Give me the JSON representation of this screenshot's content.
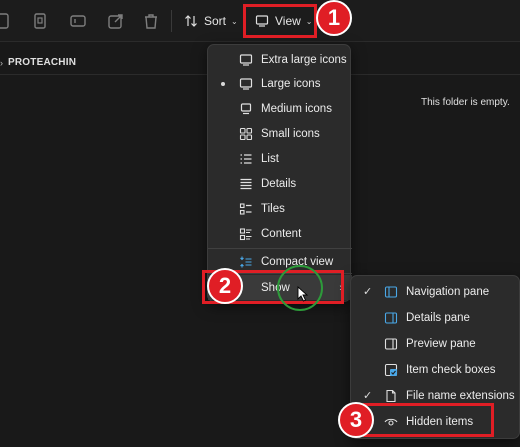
{
  "toolbar": {
    "sort_label": "Sort",
    "view_label": "View"
  },
  "address": {
    "folder": "PROTEACHIN"
  },
  "content": {
    "empty_message": "This folder is empty."
  },
  "view_menu": {
    "items": [
      {
        "label": "Extra large icons",
        "icon": "monitor-icon"
      },
      {
        "label": "Large icons",
        "icon": "monitor-icon",
        "selected": true
      },
      {
        "label": "Medium icons",
        "icon": "medium-icons-icon"
      },
      {
        "label": "Small icons",
        "icon": "small-icons-grid-icon"
      },
      {
        "label": "List",
        "icon": "list-icon"
      },
      {
        "label": "Details",
        "icon": "details-icon"
      },
      {
        "label": "Tiles",
        "icon": "tiles-icon"
      },
      {
        "label": "Content",
        "icon": "content-icon"
      },
      {
        "label": "Compact view",
        "icon": "compact-view-icon"
      },
      {
        "label": "Show",
        "icon": "",
        "has_submenu": true
      }
    ]
  },
  "show_menu": {
    "items": [
      {
        "label": "Navigation pane",
        "icon": "navigation-pane-icon",
        "checked": true
      },
      {
        "label": "Details pane",
        "icon": "details-pane-icon",
        "checked": false
      },
      {
        "label": "Preview pane",
        "icon": "preview-pane-icon",
        "checked": false
      },
      {
        "label": "Item check boxes",
        "icon": "checkbox-icon",
        "checked": false
      },
      {
        "label": "File name extensions",
        "icon": "file-icon",
        "checked": true
      },
      {
        "label": "Hidden items",
        "icon": "eye-icon",
        "checked": false
      }
    ]
  },
  "callouts": {
    "step1": "1",
    "step2": "2",
    "step3": "3"
  },
  "colors": {
    "background": "#191919",
    "menu_background": "#2b2b2b",
    "callout_red": "#e01e25",
    "cursor_ring_green": "#2d9b3a",
    "accent_blue": "#4aa8e8"
  }
}
